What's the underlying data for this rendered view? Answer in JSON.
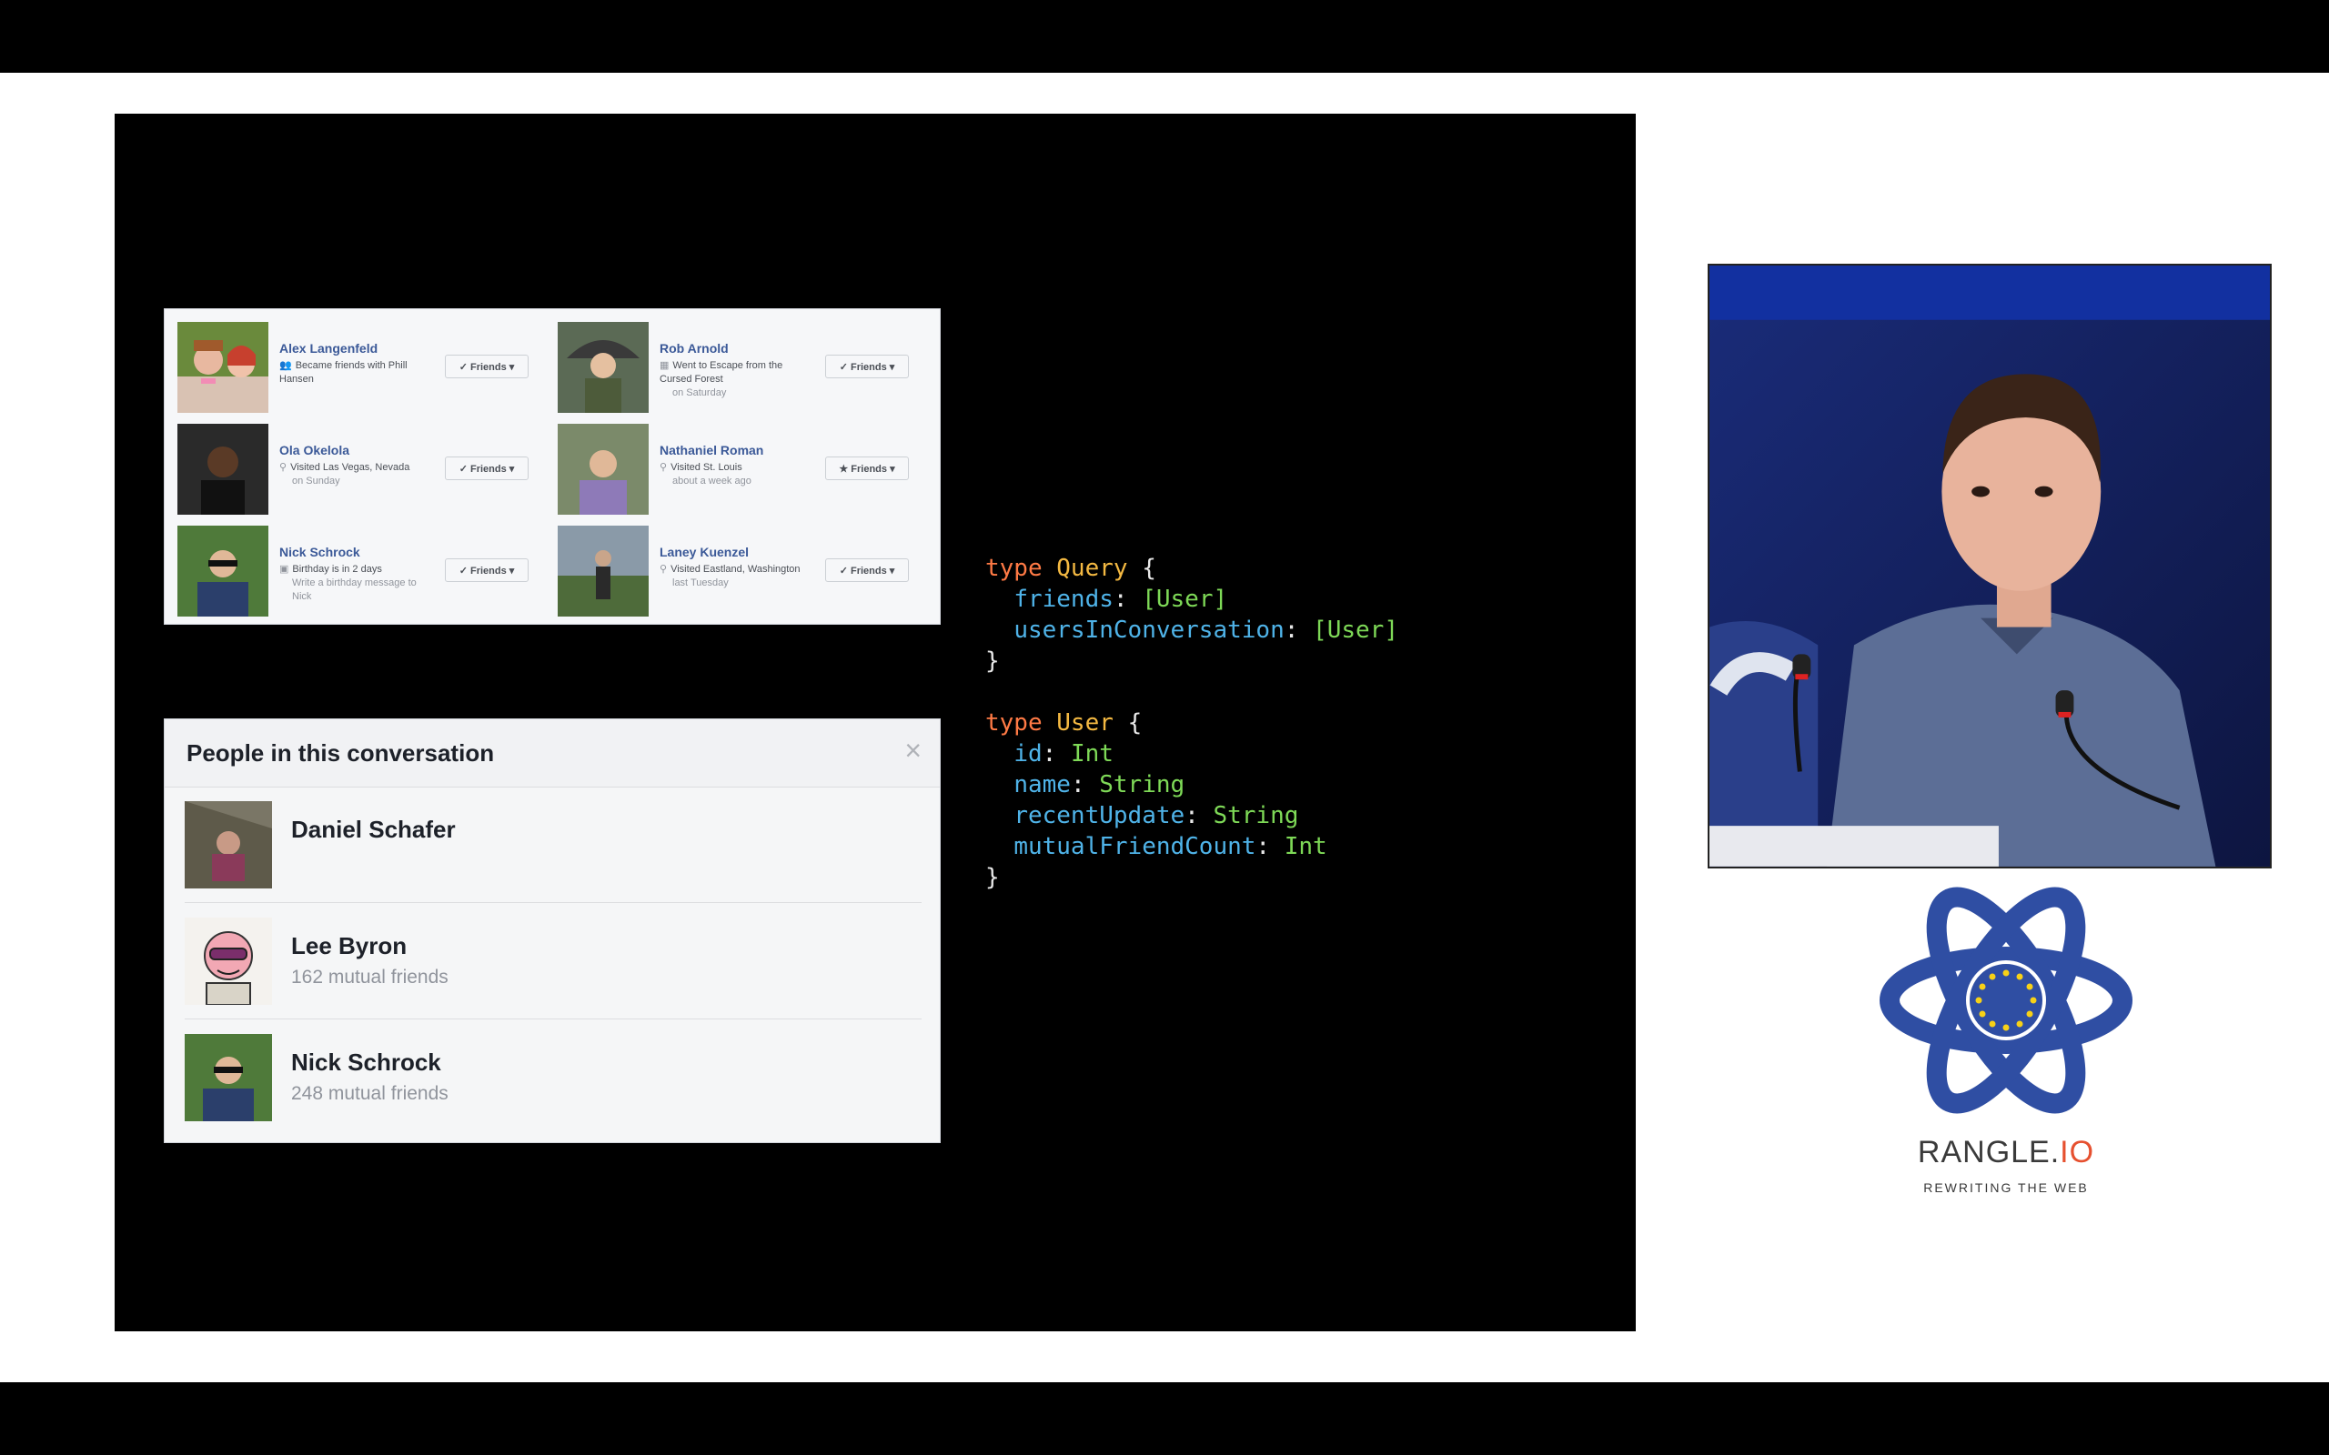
{
  "friends": [
    {
      "name": "Alex Langenfeld",
      "icon": "people-icon",
      "detail": "Became friends with Phill Hansen",
      "sub": "",
      "button": "✓ Friends ▾"
    },
    {
      "name": "Rob Arnold",
      "icon": "calendar-icon",
      "detail": "Went to Escape from the Cursed Forest",
      "sub": "on Saturday",
      "button": "✓ Friends ▾"
    },
    {
      "name": "Ola Okelola",
      "icon": "location-pin-icon",
      "detail": "Visited Las Vegas, Nevada",
      "sub": "on Sunday",
      "button": "✓ Friends ▾"
    },
    {
      "name": "Nathaniel Roman",
      "icon": "location-pin-icon",
      "detail": "Visited St. Louis",
      "sub": "about a week ago",
      "button": "★ Friends ▾"
    },
    {
      "name": "Nick Schrock",
      "icon": "birthday-icon",
      "detail": "Birthday is in 2 days",
      "sub": "Write a birthday message to Nick",
      "button": "✓ Friends ▾"
    },
    {
      "name": "Laney Kuenzel",
      "icon": "location-pin-icon",
      "detail": "Visited Eastland, Washington",
      "sub": "last Tuesday",
      "button": "✓ Friends ▾"
    }
  ],
  "conversation": {
    "title": "People in this conversation",
    "close": "×",
    "people": [
      {
        "name": "Daniel Schafer",
        "mutual": ""
      },
      {
        "name": "Lee Byron",
        "mutual": "162 mutual friends"
      },
      {
        "name": "Nick Schrock",
        "mutual": "248 mutual friends"
      }
    ]
  },
  "code": {
    "kw_type": "type",
    "query_name": "Query",
    "user_name": "User",
    "open": "{",
    "close": "}",
    "query_fields": [
      {
        "name": "friends",
        "type": "[User]"
      },
      {
        "name": "usersInConversation",
        "type": "[User]"
      }
    ],
    "user_fields": [
      {
        "name": "id",
        "type": "Int"
      },
      {
        "name": "name",
        "type": "String"
      },
      {
        "name": "recentUpdate",
        "type": "String"
      },
      {
        "name": "mutualFriendCount",
        "type": "Int"
      }
    ]
  },
  "logo": {
    "name_main": "RANGLE.",
    "name_accent": "IO",
    "tagline": "REWRITING THE WEB",
    "color_primary": "#2f4ea3",
    "color_accent": "#e6502f"
  }
}
